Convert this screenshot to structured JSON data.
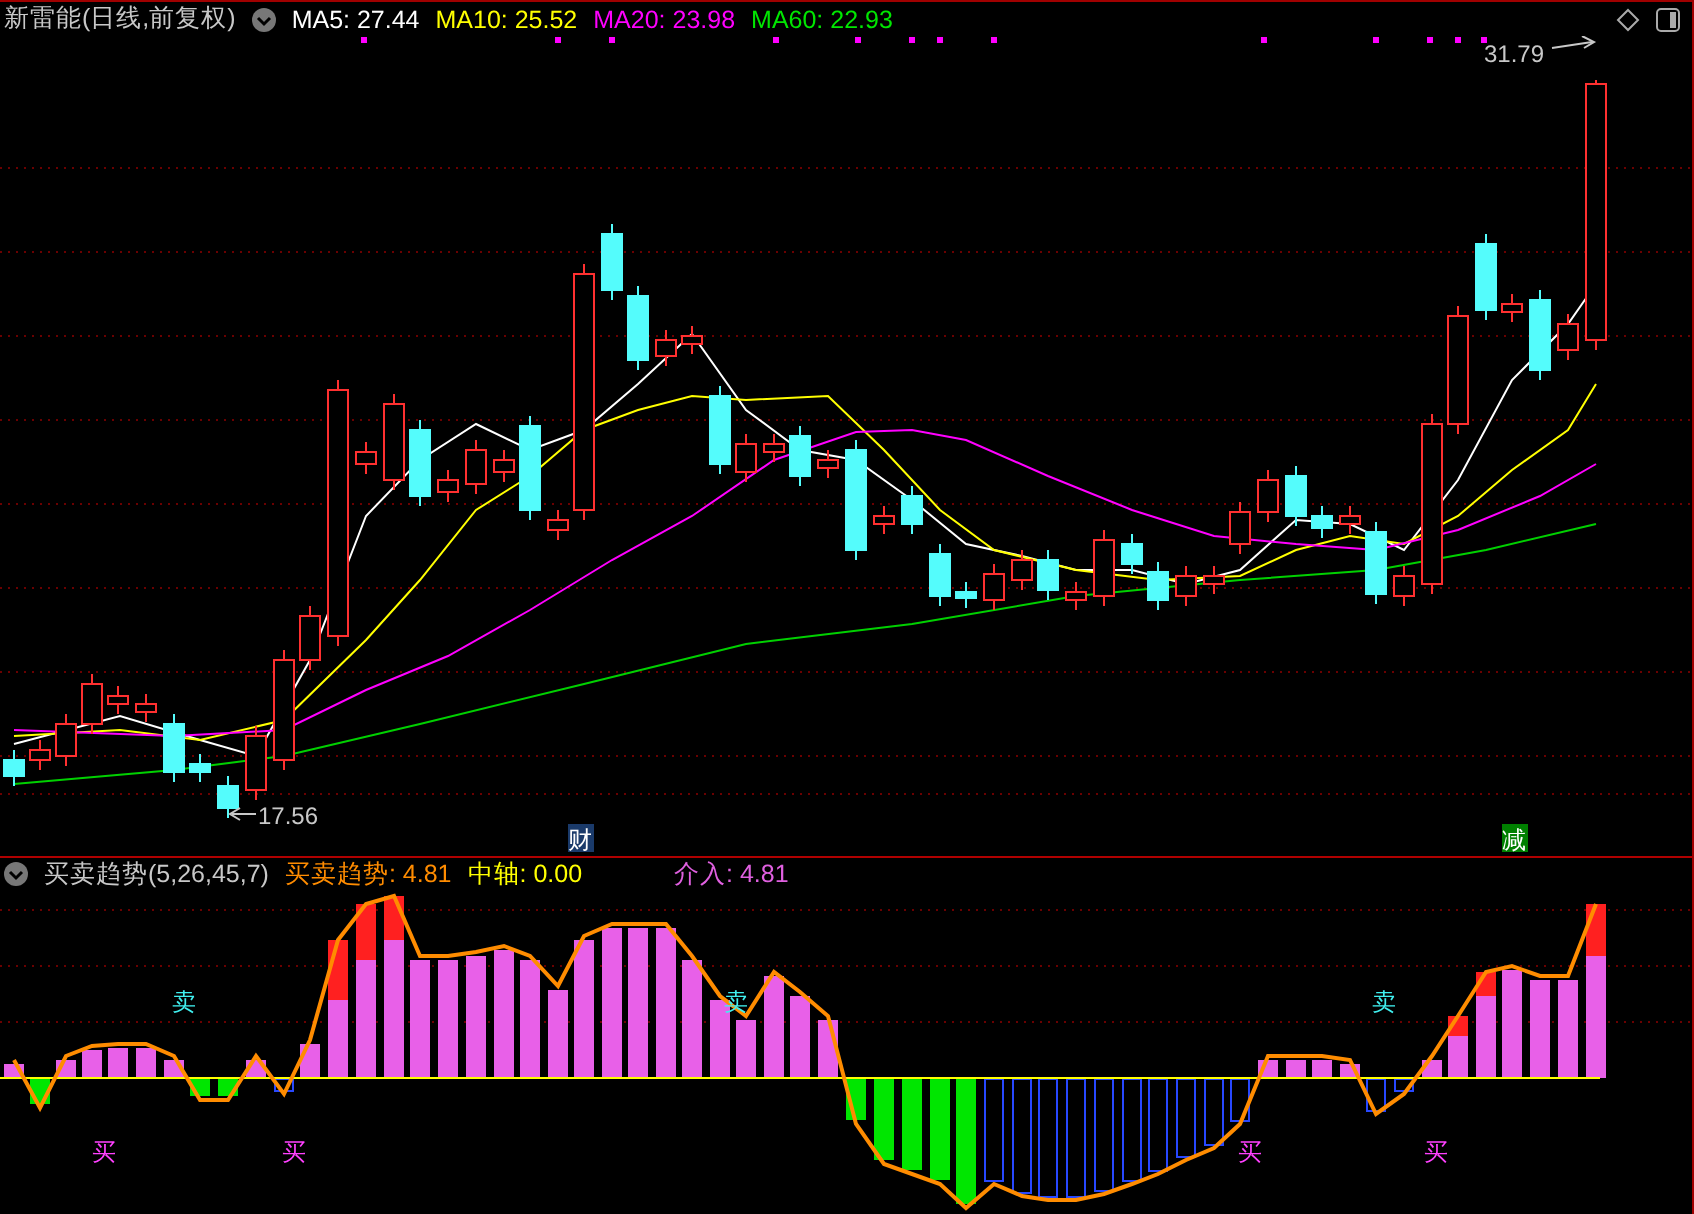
{
  "header": {
    "title": "新雷能(日线,前复权)",
    "indicators": [
      {
        "label": "MA5: 27.44",
        "color": "#ffffff"
      },
      {
        "label": "MA10: 25.52",
        "color": "#ffff00"
      },
      {
        "label": "MA20: 23.98",
        "color": "#ff00ff"
      },
      {
        "label": "MA60: 22.93",
        "color": "#00e600"
      }
    ]
  },
  "price_chart": {
    "high_label": "31.79",
    "low_label": "17.56",
    "events": [
      {
        "text": "财",
        "kind": "finance"
      },
      {
        "text": "减",
        "kind": "reduce"
      }
    ]
  },
  "indicator_panel": {
    "title": "买卖趋势(5,26,45,7)",
    "values": [
      {
        "label": "买卖趋势: 4.81",
        "color": "#ff8c00"
      },
      {
        "label": "中轴: 0.00",
        "color": "#ffff00"
      },
      {
        "label": "介入: 4.81",
        "color": "#e060e0"
      }
    ],
    "signals": [
      {
        "text": "卖",
        "kind": "sell"
      },
      {
        "text": "卖",
        "kind": "sell"
      },
      {
        "text": "卖",
        "kind": "sell"
      },
      {
        "text": "买",
        "kind": "buy"
      },
      {
        "text": "买",
        "kind": "buy"
      },
      {
        "text": "买",
        "kind": "buy"
      },
      {
        "text": "买",
        "kind": "buy"
      }
    ]
  }
}
